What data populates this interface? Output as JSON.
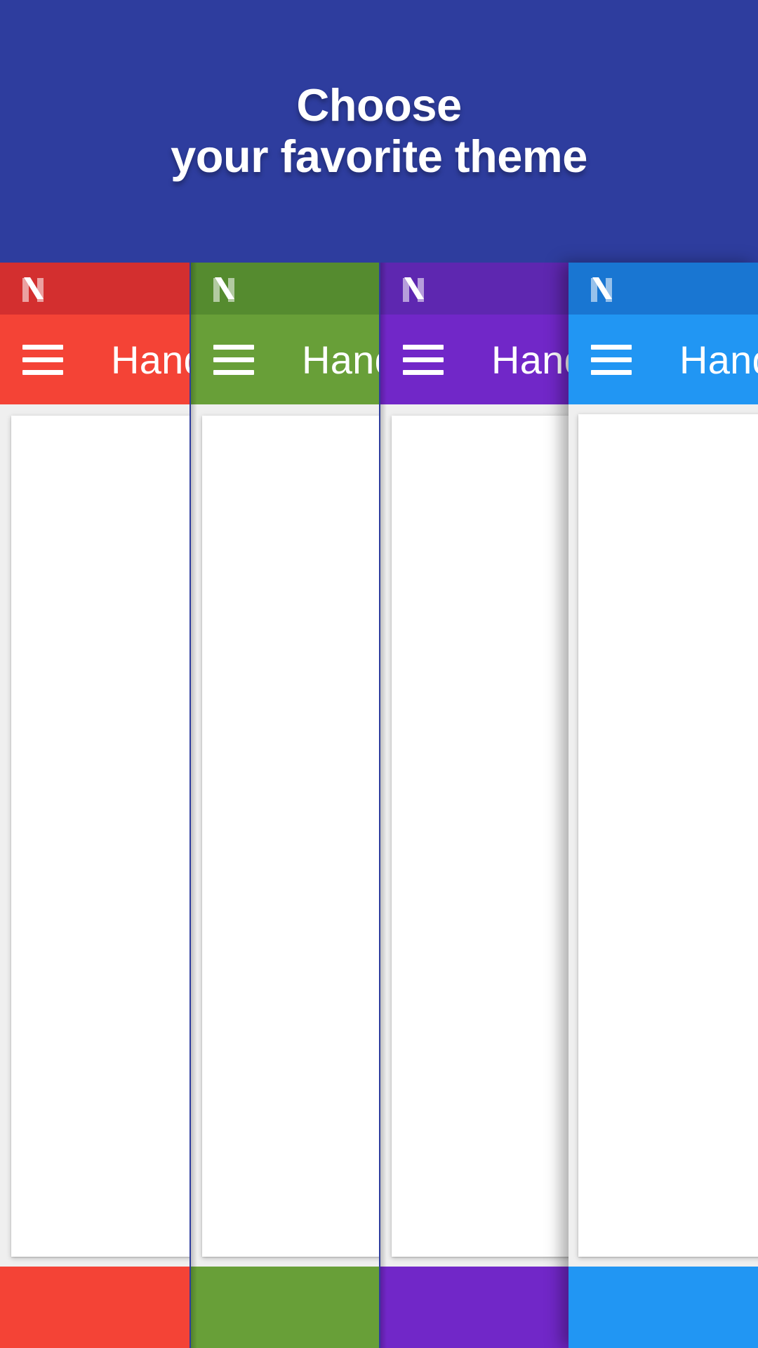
{
  "header": {
    "title": "Choose\nyour favorite theme",
    "background_color": "#2E3D9E"
  },
  "theme_picker": {
    "menu_icon_name": "hamburger-menu-icon",
    "logo_icon_name": "android-nougat-n-logo",
    "themes": [
      {
        "name": "red",
        "app_title": "Hand",
        "status_bar_color": "#D32F2F",
        "app_bar_color": "#F44336",
        "bottom_bar_color": "#F44336",
        "selected": false
      },
      {
        "name": "green",
        "app_title": "Hand",
        "status_bar_color": "#558B2F",
        "app_bar_color": "#689F38",
        "bottom_bar_color": "#689F38",
        "selected": false
      },
      {
        "name": "purple",
        "app_title": "Hand",
        "status_bar_color": "#5E27B0",
        "app_bar_color": "#7127C8",
        "bottom_bar_color": "#7127C8",
        "selected": false
      },
      {
        "name": "blue",
        "app_title": "Hand",
        "status_bar_color": "#1976D2",
        "app_bar_color": "#2196F3",
        "bottom_bar_color": "#2196F3",
        "selected": true
      }
    ]
  }
}
